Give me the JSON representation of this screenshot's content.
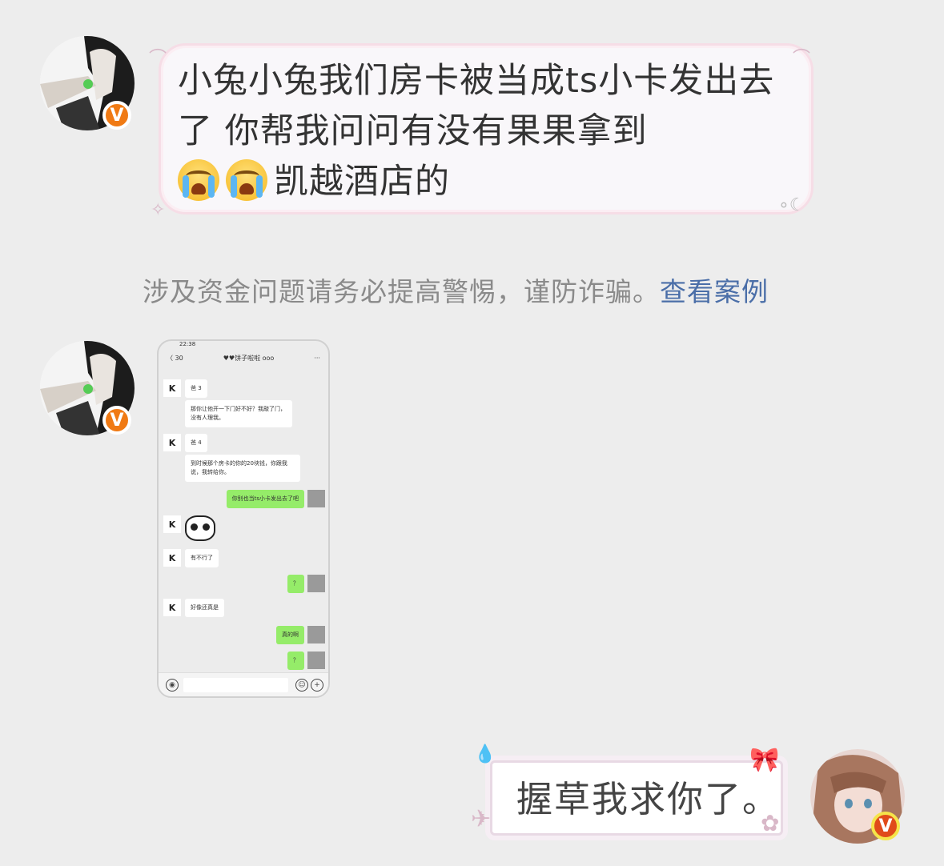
{
  "messages": [
    {
      "sender": "left",
      "badge": "V",
      "text_main": "小兔小兔我们房卡被当成ts小卡发出去了 你帮我问问有没有果果拿到",
      "text_tail": "凯越酒店的",
      "emoji": [
        "loudly-crying-face",
        "loudly-crying-face"
      ]
    },
    {
      "sender": "left",
      "badge": "V",
      "type": "image",
      "screenshot": {
        "time": "22:38",
        "back": "〈 30",
        "title": "♥♥饼子啦啦 ooo",
        "more": "···",
        "msgs": [
          {
            "side": "left",
            "avatar": "K",
            "text": "爸 3"
          },
          {
            "side": "left",
            "avatar": "",
            "text": "那你让他开一下门好不好？我敲了门，没有人理我。"
          },
          {
            "side": "left",
            "avatar": "K",
            "text": "爸 4"
          },
          {
            "side": "left",
            "avatar": "",
            "text": "到时候那个房卡的你的20块钱，你跟我说，我转给你。"
          },
          {
            "side": "right",
            "text": "你别也当ts小卡发出去了吧"
          },
          {
            "side": "left",
            "avatar": "K",
            "text": ""
          },
          {
            "side": "left",
            "avatar": "K",
            "text": "有不行了"
          },
          {
            "side": "right",
            "text": "？"
          },
          {
            "side": "left",
            "avatar": "K",
            "text": "好像还真是"
          },
          {
            "side": "right",
            "text": "真的啊"
          },
          {
            "side": "right",
            "text": "？"
          }
        ]
      }
    },
    {
      "sender": "right",
      "badge": "V",
      "text": "握草我求你了。"
    }
  ],
  "notice": {
    "text": "涉及资金问题请务必提高警惕，谨防诈骗。",
    "link": "查看案例"
  },
  "colors": {
    "background": "#ededed",
    "badge": "#f07a14",
    "link": "#4a6ea8",
    "green_bubble": "#95ec69"
  }
}
